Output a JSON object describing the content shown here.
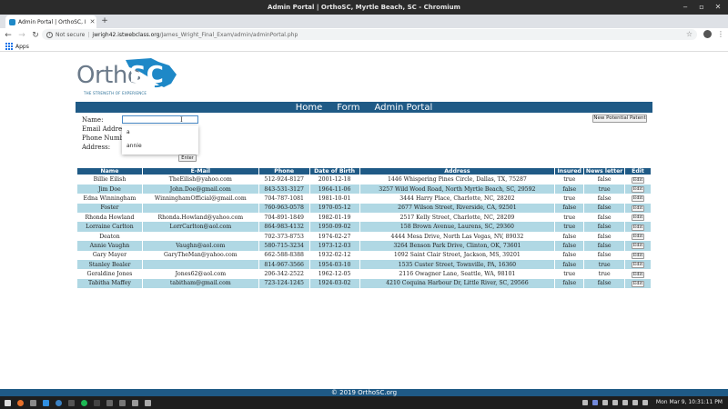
{
  "window": {
    "title": "Admin Portal | OrthoSC, Myrtle Beach, SC - Chromium"
  },
  "tab": {
    "title": "Admin Portal | OrthoSC, Myr"
  },
  "omnibox": {
    "security": "Not secure",
    "host": "jwrigh42.istwebclass.org",
    "path": "/James_Wright_Final_Exam/admin/adminPortal.php"
  },
  "bookmarks": {
    "apps_label": "Apps"
  },
  "logo": {
    "ortho": "Ortho",
    "sc": "SC",
    "tagline": "THE STRENGTH OF EXPERIENCE"
  },
  "nav": {
    "items": [
      "Home",
      "Form",
      "Admin Portal"
    ]
  },
  "form": {
    "name_label": "Name:",
    "email_label": "Email Address:",
    "phone_label": "Phone Number:",
    "address_label": "Address:",
    "autocomplete": [
      "a",
      "annie"
    ],
    "enter_label": "Enter",
    "new_patient_label": "New Potential Patent"
  },
  "table": {
    "headers": [
      "Name",
      "E-Mail",
      "Phone",
      "Date of Birth",
      "Address",
      "Insured",
      "News letter",
      "Edit"
    ],
    "edit_label": "Edit",
    "rows": [
      [
        "Billie Eilish",
        "TheEilish@yahoo.com",
        "512-924-8127",
        "2001-12-18",
        "1446 Whispering Pines Circle, Dallas, TX, 75287",
        "true",
        "false"
      ],
      [
        "Jim Doe",
        "John.Doe@gmail.com",
        "843-531-3127",
        "1964-11-06",
        "3257 Wild Wood Road, North Myrtle Beach, SC, 29592",
        "false",
        "true"
      ],
      [
        "Edna Winningham",
        "WinninghamOfficial@gmail.com",
        "704-787-1081",
        "1981-10-01",
        "3444 Harry Place, Charlotte, NC, 28202",
        "true",
        "false"
      ],
      [
        "Foster",
        "",
        "760-963-0578",
        "1970-05-12",
        "2677 Wilson Street, Riverside, CA, 92501",
        "false",
        "false"
      ],
      [
        "Rhonda Howland",
        "Rhonda.Howland@yahoo.com",
        "704-891-1849",
        "1982-01-19",
        "2517 Kelly Street, Charlotte, NC, 28209",
        "true",
        "false"
      ],
      [
        "Lorraine Carlton",
        "LorrCarlton@aol.com",
        "864-983-4132",
        "1950-09-02",
        "158 Brown Avenue, Laurens, SC, 29360",
        "true",
        "false"
      ],
      [
        "Deaton",
        "",
        "702-373-8753",
        "1974-02-27",
        "4444 Mesa Drive, North Las Vegas, NV, 89032",
        "false",
        "false"
      ],
      [
        "Annie Vaughn",
        "Vaughn@aol.com",
        "580-715-3234",
        "1973-12-03",
        "3264 Benson Park Drive, Clinton, OK, 73601",
        "false",
        "false"
      ],
      [
        "Gary Mayer",
        "GaryTheMan@yahoo.com",
        "662-588-8388",
        "1932-02-12",
        "1092 Saint Clair Street, Jackson, MS, 39201",
        "false",
        "false"
      ],
      [
        "Stanley Bealer",
        "",
        "814-967-3566",
        "1954-03-10",
        "1535 Custer Street, Townville, PA, 16360",
        "false",
        "true"
      ],
      [
        "Geraldine Jones",
        "Jones62@aol.com",
        "206-342-2522",
        "1962-12-05",
        "2116 Owagner Lane, Seattle, WA, 98101",
        "true",
        "true"
      ],
      [
        "Tabitha Maffey",
        "tabitham@gmail.com",
        "723-124-1245",
        "1924-03-02",
        "4210 Coquina Harbour Dr, Little River, SC, 29566",
        "false",
        "false"
      ]
    ]
  },
  "footer": {
    "text": "© 2019 OrthoSC.org"
  },
  "taskbar": {
    "clock": "Mon Mar 9, 10:31:11 PM"
  },
  "colors": {
    "nav_blue": "#1f5a86",
    "row_alt": "#b0d8e4",
    "footer_blue": "#1f5a86"
  }
}
